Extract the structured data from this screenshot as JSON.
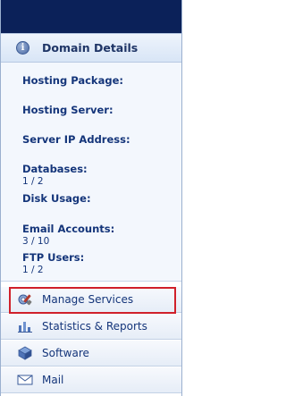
{
  "section": {
    "title": "Domain Details",
    "icon": "info-icon"
  },
  "details": {
    "hosting_package_label": "Hosting Package:",
    "hosting_server_label": "Hosting Server:",
    "server_ip_label": "Server IP Address:",
    "databases_label": "Databases:",
    "databases_value": "1 / 2",
    "disk_usage_label": "Disk Usage:",
    "email_accounts_label": "Email Accounts:",
    "email_accounts_value": "3 / 10",
    "ftp_users_label": "FTP Users:",
    "ftp_users_value": "1 / 2"
  },
  "nav": {
    "items": [
      {
        "label": "Manage Services",
        "icon": "wrench-gear-icon",
        "highlighted": true
      },
      {
        "label": "Statistics & Reports",
        "icon": "bar-chart-icon"
      },
      {
        "label": "Software",
        "icon": "software-icon"
      },
      {
        "label": "Mail",
        "icon": "mail-icon"
      }
    ]
  },
  "colors": {
    "topbar": "#0b2159",
    "text": "#14357a",
    "highlight": "#d0202a"
  }
}
